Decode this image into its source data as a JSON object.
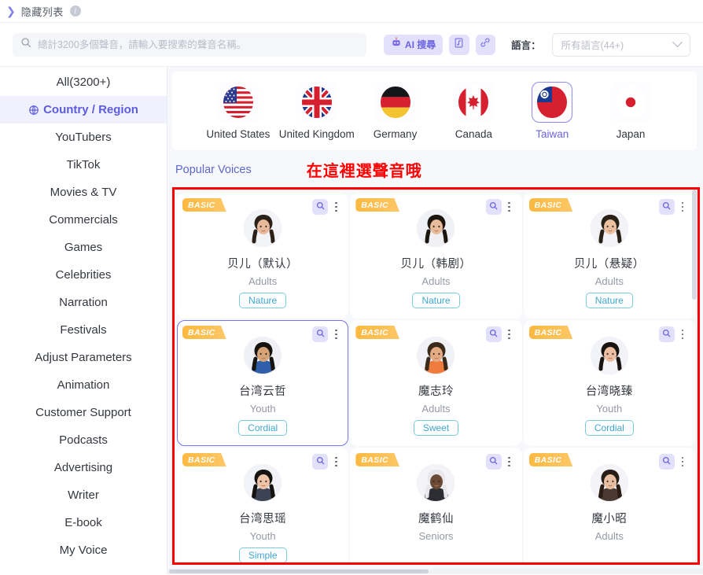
{
  "topbar": {
    "chevron_icon": "chevron-right-icon",
    "hide_list_label": "隐藏列表",
    "info_icon": "info-icon"
  },
  "search": {
    "icon": "search-icon",
    "placeholder": "總計3200多個聲音，請輸入要搜索的聲音名稱。",
    "value": "",
    "ai_button_label": "AI 搜尋",
    "ai_button_icon": "robot-icon",
    "audio_button_icon": "music-note-icon",
    "link_button_icon": "link-icon",
    "language_label": "語言：",
    "language_value": "所有語言(44+)",
    "language_chevron_icon": "chevron-down-icon"
  },
  "sidebar": {
    "items": [
      {
        "label": "All(3200+)",
        "active": false,
        "icon": null
      },
      {
        "label": "Country / Region",
        "active": true,
        "icon": "globe-icon"
      },
      {
        "label": "YouTubers",
        "active": false,
        "icon": null
      },
      {
        "label": "TikTok",
        "active": false,
        "icon": null
      },
      {
        "label": "Movies & TV",
        "active": false,
        "icon": null
      },
      {
        "label": "Commercials",
        "active": false,
        "icon": null
      },
      {
        "label": "Games",
        "active": false,
        "icon": null
      },
      {
        "label": "Celebrities",
        "active": false,
        "icon": null
      },
      {
        "label": "Narration",
        "active": false,
        "icon": null
      },
      {
        "label": "Festivals",
        "active": false,
        "icon": null
      },
      {
        "label": "Adjust Parameters",
        "active": false,
        "icon": null
      },
      {
        "label": "Animation",
        "active": false,
        "icon": null
      },
      {
        "label": "Customer Support",
        "active": false,
        "icon": null
      },
      {
        "label": "Podcasts",
        "active": false,
        "icon": null
      },
      {
        "label": "Advertising",
        "active": false,
        "icon": null
      },
      {
        "label": "Writer",
        "active": false,
        "icon": null
      },
      {
        "label": "E-book",
        "active": false,
        "icon": null
      },
      {
        "label": "My Voice",
        "active": false,
        "icon": null
      }
    ]
  },
  "countries": [
    {
      "name": "United States",
      "flag": "flag-us",
      "active": false
    },
    {
      "name": "United Kingdom",
      "flag": "flag-uk",
      "active": false
    },
    {
      "name": "Germany",
      "flag": "flag-de",
      "active": false
    },
    {
      "name": "Canada",
      "flag": "flag-ca",
      "active": false
    },
    {
      "name": "Taiwan",
      "flag": "flag-tw",
      "active": true
    },
    {
      "name": "Japan",
      "flag": "flag-jp",
      "active": false
    }
  ],
  "section": {
    "popular_voices_label": "Popular Voices",
    "annotation": "在這裡選聲音哦",
    "annotation_color": "#ff0000",
    "highlight_box_color": "#ff0000"
  },
  "voices": [
    {
      "badge": "BASIC",
      "name": "贝儿（默认）",
      "age": "Adults",
      "tag": "Nature",
      "avatar": "woman-a",
      "selected": false
    },
    {
      "badge": "BASIC",
      "name": "贝儿（韩剧）",
      "age": "Adults",
      "tag": "Nature",
      "avatar": "woman-b",
      "selected": false
    },
    {
      "badge": "BASIC",
      "name": "贝儿（悬疑）",
      "age": "Adults",
      "tag": "Nature",
      "avatar": "woman-c",
      "selected": false
    },
    {
      "badge": "BASIC",
      "name": "台湾云哲",
      "age": "Youth",
      "tag": "Cordial",
      "avatar": "man-a",
      "selected": true
    },
    {
      "badge": "BASIC",
      "name": "魔志玲",
      "age": "Adults",
      "tag": "Sweet",
      "avatar": "girl-a",
      "selected": false
    },
    {
      "badge": "BASIC",
      "name": "台湾晓臻",
      "age": "Youth",
      "tag": "Cordial",
      "avatar": "woman-d",
      "selected": false
    },
    {
      "badge": "BASIC",
      "name": "台湾思瑶",
      "age": "Youth",
      "tag": "Simple",
      "avatar": "woman-e",
      "selected": false
    },
    {
      "badge": "BASIC",
      "name": "魔鹤仙",
      "age": "Seniors",
      "tag": null,
      "avatar": "senior-a",
      "selected": false
    },
    {
      "badge": "BASIC",
      "name": "魔小昭",
      "age": "Adults",
      "tag": null,
      "avatar": "woman-f",
      "selected": false
    }
  ],
  "colors": {
    "accent": "#6b63e0",
    "badge": "#fcb941",
    "tag": "#3fa6d4",
    "annotation": "#ff0000"
  }
}
